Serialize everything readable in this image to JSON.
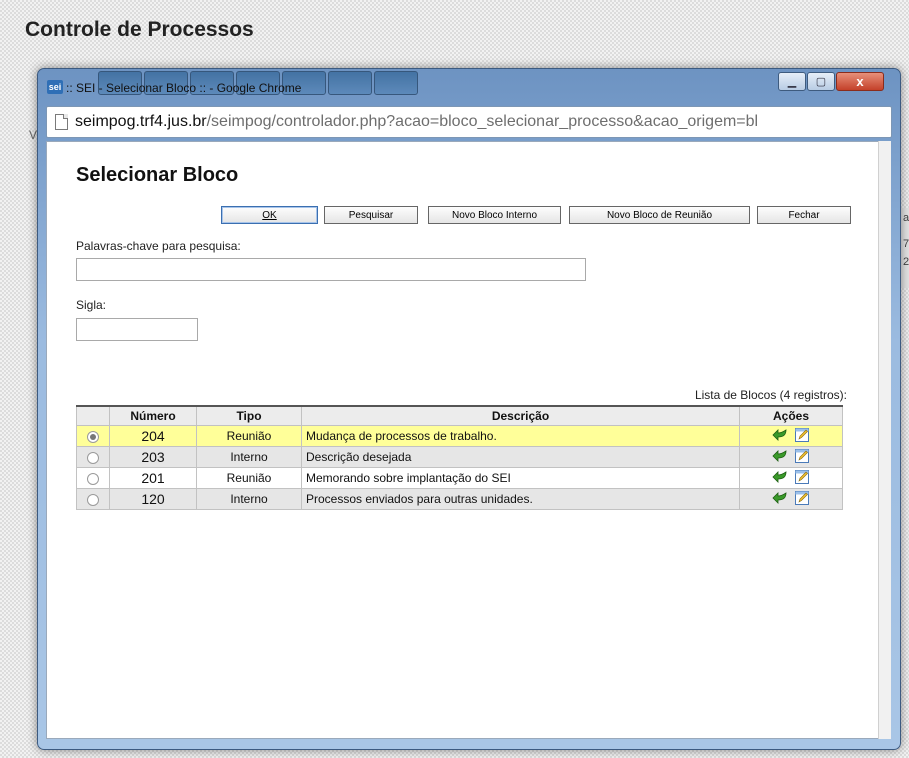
{
  "background": {
    "title": "Controle de Processos",
    "letter_v": "V",
    "right_fragments": [
      "a",
      "7",
      "2"
    ]
  },
  "window": {
    "title": ":: SEI - Selecionar Bloco :: - Google Chrome",
    "logo": "sei",
    "url_host": "seimpog.trf4.jus.br",
    "url_path": "/seimpog/controlador.php?acao=bloco_selecionar_processo&acao_origem=bl",
    "controls": {
      "minimize": "▁",
      "maximize": "▢",
      "close": "x"
    }
  },
  "page": {
    "heading": "Selecionar Bloco",
    "buttons": {
      "ok": "OK",
      "pesquisar": "Pesquisar",
      "novo_interno": "Novo Bloco Interno",
      "novo_reuniao": "Novo Bloco de Reunião",
      "fechar": "Fechar"
    },
    "search_label": "Palavras-chave para pesquisa:",
    "search_value": "",
    "sigla_label": "Sigla:",
    "sigla_value": "",
    "list_caption": "Lista de Blocos (4 registros):"
  },
  "table": {
    "headers": [
      "",
      "Número",
      "Tipo",
      "Descrição",
      "Ações"
    ],
    "rows": [
      {
        "numero": "204",
        "tipo": "Reunião",
        "descricao": "Mudança de processos de trabalho.",
        "selected": true
      },
      {
        "numero": "203",
        "tipo": "Interno",
        "descricao": "Descrição desejada",
        "selected": false
      },
      {
        "numero": "201",
        "tipo": "Reunião",
        "descricao": "Memorando sobre implantação do SEI",
        "selected": false
      },
      {
        "numero": "120",
        "tipo": "Interno",
        "descricao": "Processos enviados para outras unidades.",
        "selected": false
      }
    ]
  },
  "colors": {
    "selected_row": "#ffff99",
    "alt_row": "#e6e6e6",
    "number_green": "#2c8a2c"
  },
  "icons": {
    "action_select": "green-arrow-icon",
    "action_edit": "edit-pencil-icon"
  }
}
